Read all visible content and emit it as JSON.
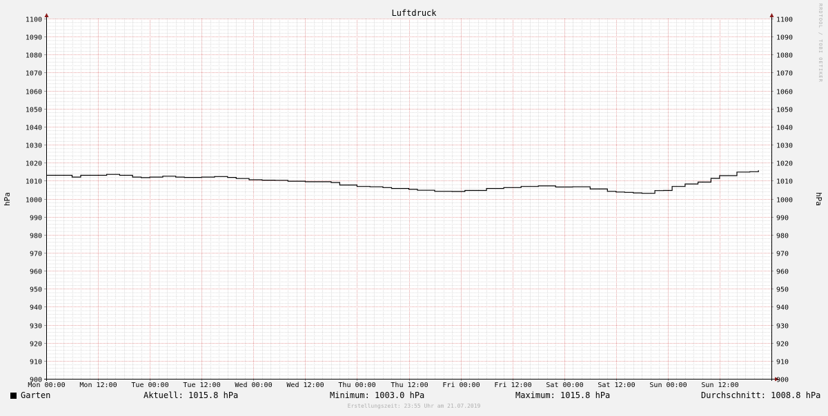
{
  "chart_data": {
    "type": "line",
    "title": "Luftdruck",
    "ylabel": "hPa",
    "ylabel_right": "hPa",
    "ylim": [
      900,
      1100
    ],
    "y_ticks": [
      900,
      910,
      920,
      930,
      940,
      950,
      960,
      970,
      980,
      990,
      1000,
      1010,
      1020,
      1030,
      1040,
      1050,
      1060,
      1070,
      1080,
      1090,
      1100
    ],
    "xlim": [
      "Mon 00:00",
      "Sun 23:55"
    ],
    "x_ticks": [
      "Mon 00:00",
      "Mon 12:00",
      "Tue 00:00",
      "Tue 12:00",
      "Wed 00:00",
      "Wed 12:00",
      "Thu 00:00",
      "Thu 12:00",
      "Fri 00:00",
      "Fri 12:00",
      "Sat 00:00",
      "Sat 12:00",
      "Sun 00:00",
      "Sun 12:00"
    ],
    "x_tick_hours": [
      0,
      12,
      24,
      36,
      48,
      60,
      72,
      84,
      96,
      108,
      120,
      132,
      144,
      156
    ],
    "x_range_hours": [
      0,
      168
    ],
    "grid": true,
    "series": [
      {
        "name": "Garten",
        "color": "#000000",
        "x_hours": [
          0,
          3,
          6,
          8,
          11,
          14,
          17,
          20,
          22,
          24,
          27,
          30,
          32,
          36,
          39,
          42,
          44,
          47,
          50,
          53,
          56,
          60,
          62,
          66,
          68,
          72,
          75,
          78,
          80,
          84,
          86,
          90,
          94,
          97,
          102,
          106,
          110,
          114,
          118,
          122,
          126,
          130,
          132,
          134,
          136,
          138,
          141,
          143,
          145,
          148,
          151,
          154,
          156,
          160,
          163,
          165
        ],
        "values": [
          1013,
          1013,
          1012,
          1013,
          1013,
          1013.5,
          1013,
          1012,
          1011.7,
          1012,
          1012.5,
          1012,
          1011.8,
          1012,
          1012.3,
          1011.8,
          1011.2,
          1010.5,
          1010.3,
          1010.2,
          1009.7,
          1009.4,
          1009.4,
          1009,
          1007.6,
          1006.8,
          1006.6,
          1006.2,
          1005.7,
          1005.2,
          1004.7,
          1004.1,
          1004,
          1004.6,
          1005.7,
          1006.2,
          1006.8,
          1007.1,
          1006.5,
          1006.6,
          1005.4,
          1004.1,
          1003.7,
          1003.5,
          1003.2,
          1003,
          1004.5,
          1004.6,
          1006.8,
          1008.2,
          1009.2,
          1011.3,
          1012.8,
          1014.8,
          1015,
          1015.8
        ]
      }
    ]
  },
  "legend": {
    "series_name": "Garten",
    "aktuell": "Aktuell: 1015.8 hPa",
    "minimum": "Minimum: 1003.0 hPa",
    "maximum": "Maximum: 1015.8 hPa",
    "durchschnitt": "Durchschnitt: 1008.8 hPa"
  },
  "watermark": "RRDTOOL / TOBI OETIKER",
  "footer": "Erstellungszeit: 23:55 Uhr am 21.07.2019"
}
